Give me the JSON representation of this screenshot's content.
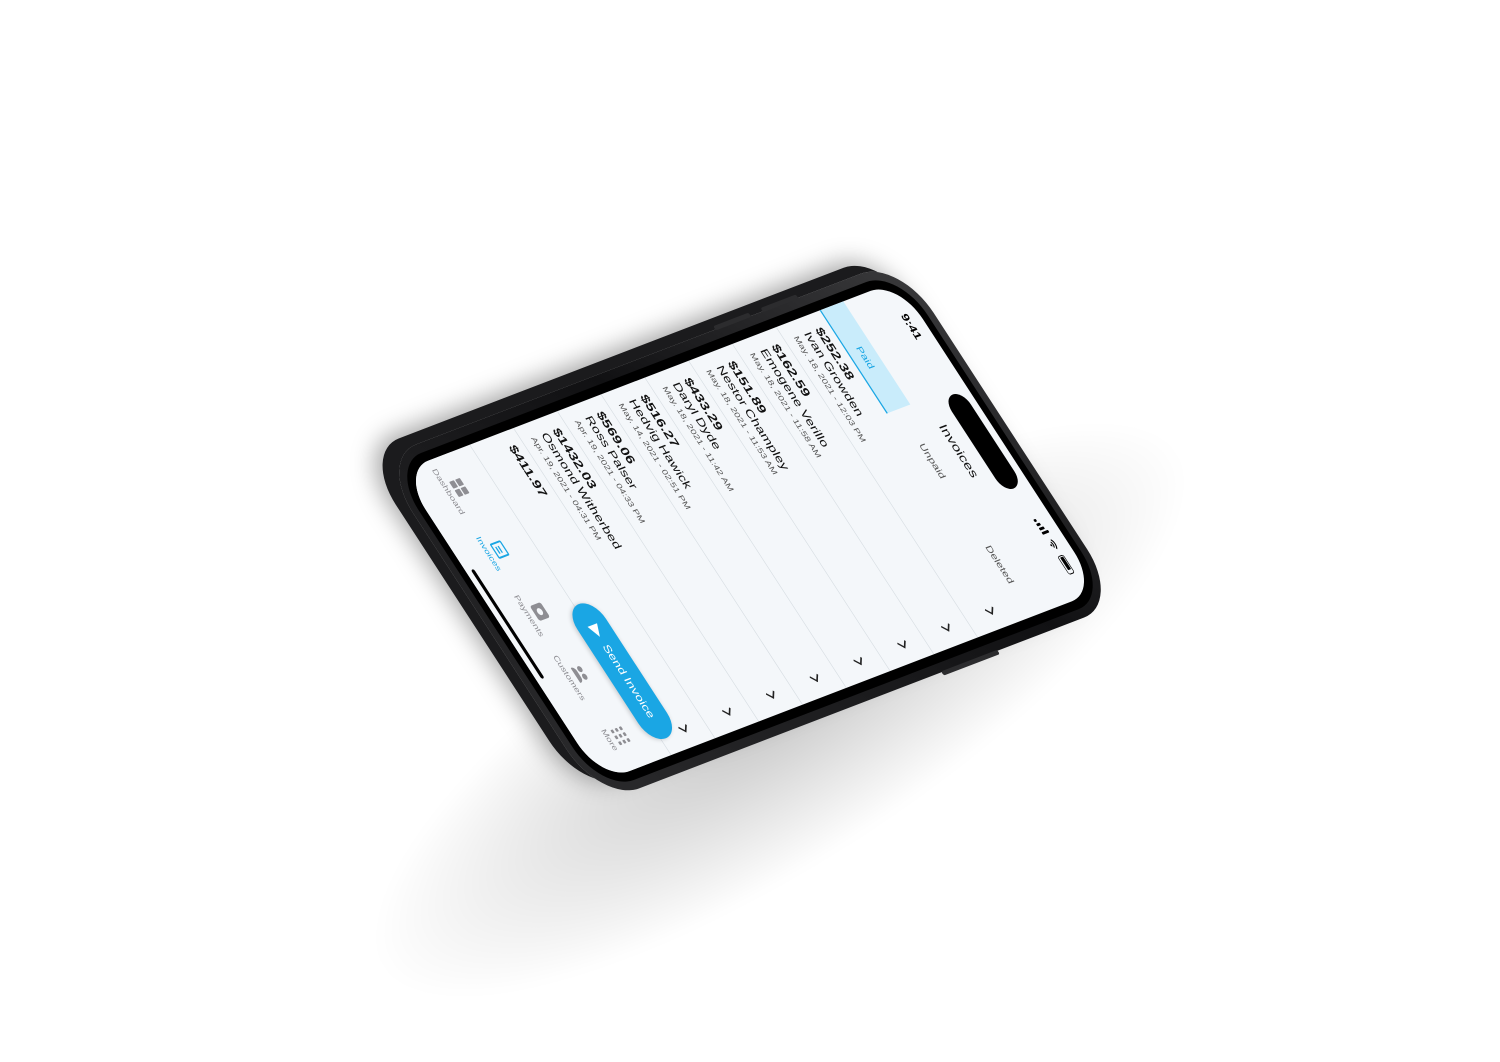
{
  "status_bar": {
    "time": "9:41"
  },
  "header": {
    "title": "Invoices"
  },
  "tabs": [
    {
      "label": "Paid",
      "active": true
    },
    {
      "label": "Unpaid",
      "active": false
    },
    {
      "label": "Deleted",
      "active": false
    }
  ],
  "invoices": [
    {
      "amount": "$252.38",
      "name": "Ivan Growden",
      "date": "May. 18, 2021 - 12:03 PM"
    },
    {
      "amount": "$162.59",
      "name": "Emogene Verillo",
      "date": "May. 18, 2021 - 11:58 AM"
    },
    {
      "amount": "$151.89",
      "name": "Nestor Champley",
      "date": "May. 18, 2021 - 11:53 AM"
    },
    {
      "amount": "$433.29",
      "name": "Daryl Dyde",
      "date": "May. 18, 2021 - 11:42 AM"
    },
    {
      "amount": "$516.27",
      "name": "Hedvig Hawick",
      "date": "May. 14, 2021 - 02:51 PM"
    },
    {
      "amount": "$569.06",
      "name": "Ross Palser",
      "date": "Apr. 19, 2021 - 04:33 PM"
    },
    {
      "amount": "$1432.03",
      "name": "Osmond Witherbed",
      "date": "Apr. 19, 2021 - 04:31 PM"
    },
    {
      "amount": "$411.97",
      "name": "",
      "date": ""
    }
  ],
  "send_button": {
    "label": "Send Invoice",
    "icon": "paper-plane-icon"
  },
  "tabbar": [
    {
      "label": "Dashboard",
      "icon": "dashboard-icon",
      "active": false
    },
    {
      "label": "Invoices",
      "icon": "invoice-icon",
      "active": true
    },
    {
      "label": "Payments",
      "icon": "payments-icon",
      "active": false
    },
    {
      "label": "Customers",
      "icon": "customers-icon",
      "active": false
    },
    {
      "label": "More",
      "icon": "more-grid-icon",
      "active": false
    }
  ],
  "colors": {
    "accent": "#1aa6e4",
    "active_tab_bg": "#c9ecfb",
    "screen_bg": "#f4f7fa"
  }
}
